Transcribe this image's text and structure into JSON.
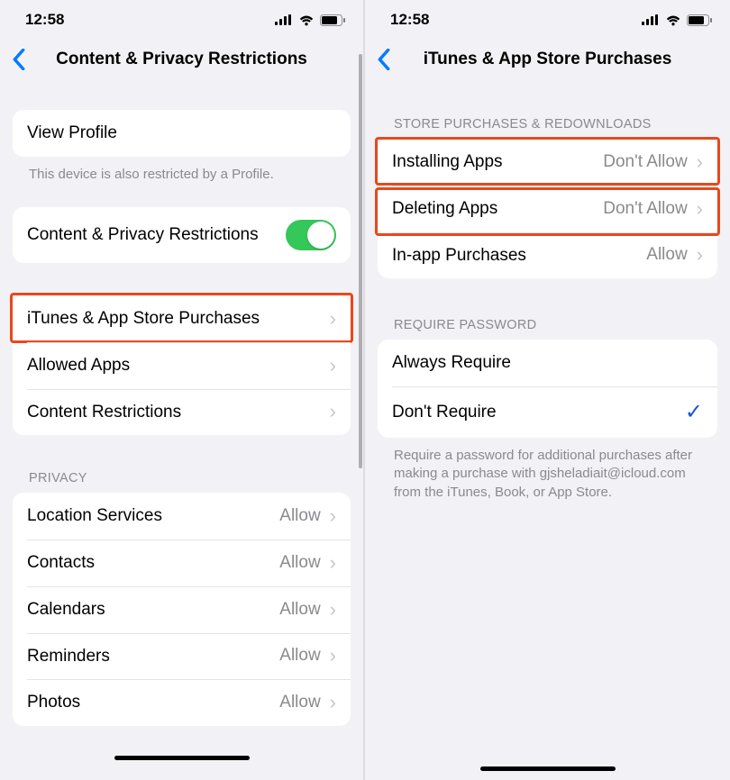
{
  "status": {
    "time": "12:58"
  },
  "left": {
    "title": "Content & Privacy Restrictions",
    "view_profile": "View Profile",
    "profile_note": "This device is also restricted by a Profile.",
    "main_toggle_label": "Content & Privacy Restrictions",
    "rows": {
      "itunes": "iTunes & App Store Purchases",
      "allowed": "Allowed Apps",
      "content": "Content Restrictions"
    },
    "privacy_header": "PRIVACY",
    "privacy_rows": [
      {
        "label": "Location Services",
        "value": "Allow"
      },
      {
        "label": "Contacts",
        "value": "Allow"
      },
      {
        "label": "Calendars",
        "value": "Allow"
      },
      {
        "label": "Reminders",
        "value": "Allow"
      },
      {
        "label": "Photos",
        "value": "Allow"
      }
    ]
  },
  "right": {
    "title": "iTunes & App Store Purchases",
    "section1_header": "STORE PURCHASES & REDOWNLOADS",
    "rows1": [
      {
        "label": "Installing Apps",
        "value": "Don't Allow"
      },
      {
        "label": "Deleting Apps",
        "value": "Don't Allow"
      },
      {
        "label": "In-app Purchases",
        "value": "Allow"
      }
    ],
    "section2_header": "REQUIRE PASSWORD",
    "rows2": [
      {
        "label": "Always Require",
        "checked": false
      },
      {
        "label": "Don't Require",
        "checked": true
      }
    ],
    "footnote": "Require a password for additional purchases after making a purchase with gjsheladiait@icloud.com from the iTunes, Book, or App Store."
  }
}
